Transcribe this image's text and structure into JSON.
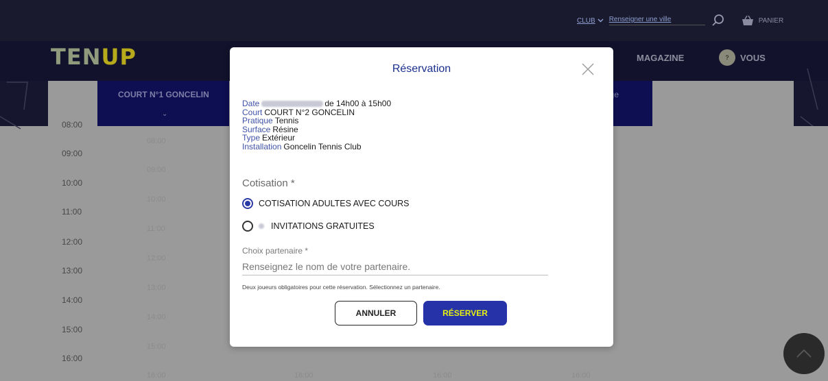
{
  "header": {
    "club_select": "CLUB",
    "city_placeholder": "Renseigner une ville",
    "basket_label": "PANIER",
    "logo_left": "TEN",
    "logo_right": "UP",
    "nav_magazine": "MAGAZINE",
    "nav_vous": "VOUS"
  },
  "schedule": {
    "court1": "COURT N°1 GONCELIN",
    "court_right_partial": "ège",
    "hours": [
      "08:00",
      "09:00",
      "10:00",
      "11:00",
      "12:00",
      "13:00",
      "14:00",
      "15:00",
      "16:00"
    ],
    "slots_col1": [
      "08:00",
      "09:00",
      "10:00",
      "11:00",
      "12:00",
      "13:00",
      "14:00",
      "15:00",
      "16:00"
    ],
    "bottom_slots": [
      "16:00",
      "16:00",
      "16:00"
    ]
  },
  "modal": {
    "title": "Réservation",
    "date_key": "Date",
    "date_value": "de 14h00 à 15h00",
    "court_key": "Court",
    "court_value": "COURT N°2 GONCELIN",
    "pratique_key": "Pratique",
    "pratique_value": "Tennis",
    "surface_key": "Surface",
    "surface_value": "Résine",
    "type_key": "Type",
    "type_value": "Extérieur",
    "installation_key": "Installation",
    "installation_value": "Goncelin Tennis Club",
    "cotisation_label": "Cotisation *",
    "options": [
      {
        "label": "COTISATION ADULTES AVEC COURS",
        "selected": true
      },
      {
        "label": "INVITATIONS GRATUITES",
        "selected": false
      }
    ],
    "partner_label": "Choix partenaire *",
    "partner_placeholder": "Renseignez le nom de votre partenaire.",
    "hint": "Deux joueurs obligatoires pour cette réservation. Sélectionnez un partenaire.",
    "cancel": "ANNULER",
    "reserve": "RÉSERVER"
  },
  "colors": {
    "accent": "#2532a8",
    "reserve_text": "#e7f20f",
    "title": "#1b2f8f"
  }
}
